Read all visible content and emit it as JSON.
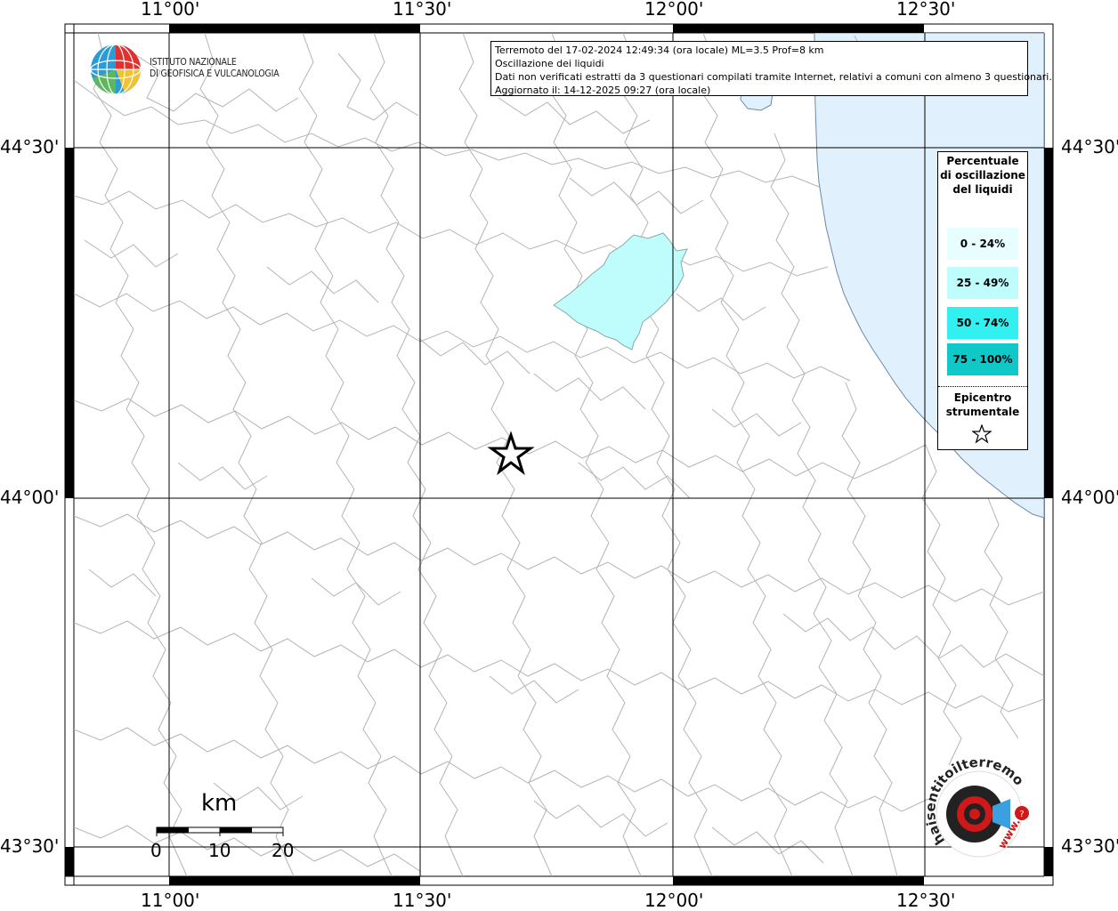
{
  "header": {
    "line1": "Terremoto del 17-02-2024 12:49:34 (ora locale) ML=3.5 Prof=8 km",
    "line2": "Oscillazione dei liquidi",
    "line3": "Dati non verificati estratti da 3 questionari compilati tramite Internet, relativi a comuni con almeno 3 questionari.",
    "line4": "Aggiornato il: 14-12-2025 09:27 (ora locale)"
  },
  "logo": {
    "line1": "ISTITUTO NAZIONALE",
    "line2": "DI GEOFISICA E VULCANOLOGIA"
  },
  "coords": {
    "lon_1100": "11°00'",
    "lon_1130": "11°30'",
    "lon_1200": "12°00'",
    "lon_1230": "12°30'",
    "lat_4430": "44°30'",
    "lat_4400": "44°00'",
    "lat_4330": "43°30'"
  },
  "legend": {
    "title": "Percentuale di oscillazione del liquidi",
    "items": [
      {
        "label": "0 - 24%",
        "color": "#e8fefe"
      },
      {
        "label": "25 - 49%",
        "color": "#bffcfc"
      },
      {
        "label": "50 - 74%",
        "color": "#33f0f0"
      },
      {
        "label": "75 - 100%",
        "color": "#10c8c8"
      }
    ],
    "epicenter_label": "Epicentro strumentale",
    "star_icon": "star-outline-icon"
  },
  "scale": {
    "unit": "km",
    "tick_0": "0",
    "tick_10": "10",
    "tick_20": "20"
  },
  "colors": {
    "sea": "#e0f0fc",
    "highlight_region": "#bffcfc",
    "boundary": "#b4b4b4"
  },
  "brand": {
    "logo_text": "haisentitoilterremoto.it",
    "badge_text": "www."
  }
}
